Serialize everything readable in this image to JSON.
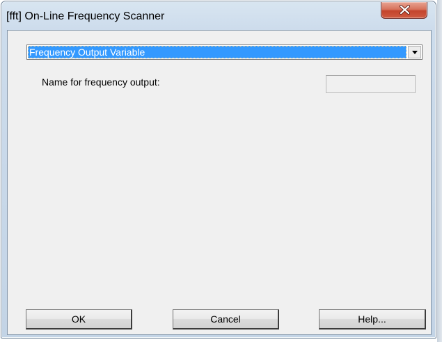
{
  "window": {
    "title": "[fft] On-Line Frequency Scanner"
  },
  "controls": {
    "section_selected": "Frequency Output Variable",
    "section_label": "Name for frequency output:",
    "name_value": ""
  },
  "buttons": {
    "ok": "OK",
    "cancel": "Cancel",
    "help": "Help..."
  },
  "icons": {
    "close": "close-icon",
    "dropdown": "chevron-down-icon"
  },
  "colors": {
    "selection": "#3399ff",
    "close_button": "#c4442d",
    "dialog_background": "#f0f0f0",
    "frame": "#cddcec"
  }
}
